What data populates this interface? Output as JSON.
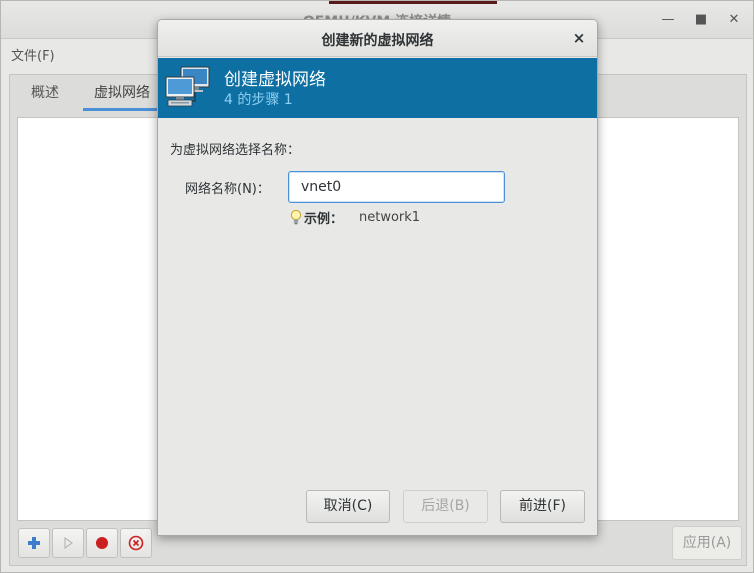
{
  "bg_window": {
    "title": "QEMU/KVM 连接详情",
    "menu_file": "文件(F)",
    "tabs": [
      "概述",
      "虚拟网络"
    ],
    "apply_label": "应用(A)",
    "window_controls": [
      "minimize-icon",
      "maximize-icon",
      "close-icon"
    ],
    "toolbar_icons": [
      "add-icon",
      "play-icon",
      "record-icon",
      "stop-icon"
    ]
  },
  "dialog": {
    "title": "创建新的虚拟网络",
    "close_glyph": "×",
    "banner": {
      "icon": "network-icon",
      "title": "创建虚拟网络",
      "step": "4 的步骤 1"
    },
    "prompt": "为虚拟网络选择名称：",
    "network_name_label": "网络名称(N)：",
    "network_name_value": "vnet0",
    "hint_label": "示例：",
    "hint_value": "network1",
    "buttons": {
      "cancel": "取消(C)",
      "back": "后退(B)",
      "forward": "前进(F)"
    }
  },
  "colors": {
    "banner": "#0e6fa3",
    "banner_step_text": "#8fd0f2",
    "focus": "#4a90d9",
    "add_icon": "#3d7dc9",
    "record_icon": "#cc1f1f"
  }
}
